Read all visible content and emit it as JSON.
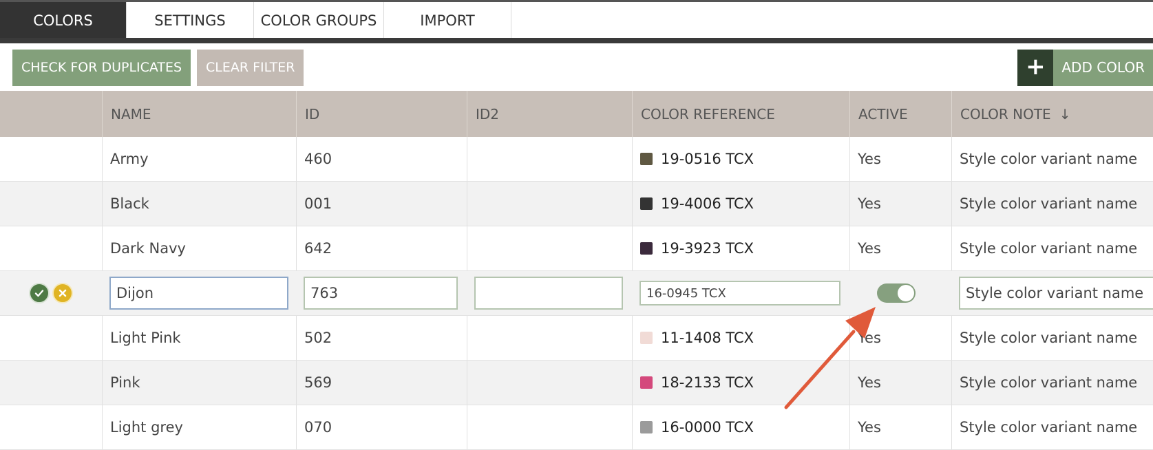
{
  "tabs": [
    {
      "label": "COLORS",
      "active": true
    },
    {
      "label": "SETTINGS",
      "active": false
    },
    {
      "label": "COLOR GROUPS",
      "active": false
    },
    {
      "label": "IMPORT",
      "active": false
    }
  ],
  "toolbar": {
    "check_duplicates_label": "CHECK FOR DUPLICATES",
    "clear_filter_label": "CLEAR FILTER",
    "add_color_label": "ADD COLOR",
    "add_icon": "plus-icon"
  },
  "table": {
    "columns": [
      "NAME",
      "ID",
      "ID2",
      "COLOR REFERENCE",
      "ACTIVE",
      "COLOR NOTE"
    ],
    "sort_indicator": "↓",
    "rows": [
      {
        "name": "Army",
        "id": "460",
        "id2": "",
        "ref": "19-0516 TCX",
        "swatch": "#5f5842",
        "active": "Yes",
        "note": "Style color variant name"
      },
      {
        "name": "Black",
        "id": "001",
        "id2": "",
        "ref": "19-4006 TCX",
        "swatch": "#333333",
        "active": "Yes",
        "note": "Style color variant name"
      },
      {
        "name": "Dark Navy",
        "id": "642",
        "id2": "",
        "ref": "19-3923 TCX",
        "swatch": "#3b2a3c",
        "active": "Yes",
        "note": "Style color variant name"
      },
      {
        "name": "Light Pink",
        "id": "502",
        "id2": "",
        "ref": "11-1408 TCX",
        "swatch": "#f1dbd6",
        "active": "Yes",
        "note": "Style color variant name"
      },
      {
        "name": "Pink",
        "id": "569",
        "id2": "",
        "ref": "18-2133 TCX",
        "swatch": "#d4497c",
        "active": "Yes",
        "note": "Style color variant name"
      },
      {
        "name": "Light grey",
        "id": "070",
        "id2": "",
        "ref": "16-0000 TCX",
        "swatch": "#9b9b9b",
        "active": "Yes",
        "note": "Style color variant name"
      }
    ],
    "edit_row": {
      "name": "Dijon",
      "id": "763",
      "id2": "",
      "ref": "16-0945 TCX",
      "active_on": true,
      "note": "Style color variant name",
      "save_icon": "check-circle-icon",
      "cancel_icon": "x-circle-icon"
    }
  },
  "colors": {
    "accent_green": "#83a07b",
    "dark_green": "#2f402e",
    "header_bg": "#c8bfb8",
    "annotation_arrow": "#e05a3a"
  }
}
